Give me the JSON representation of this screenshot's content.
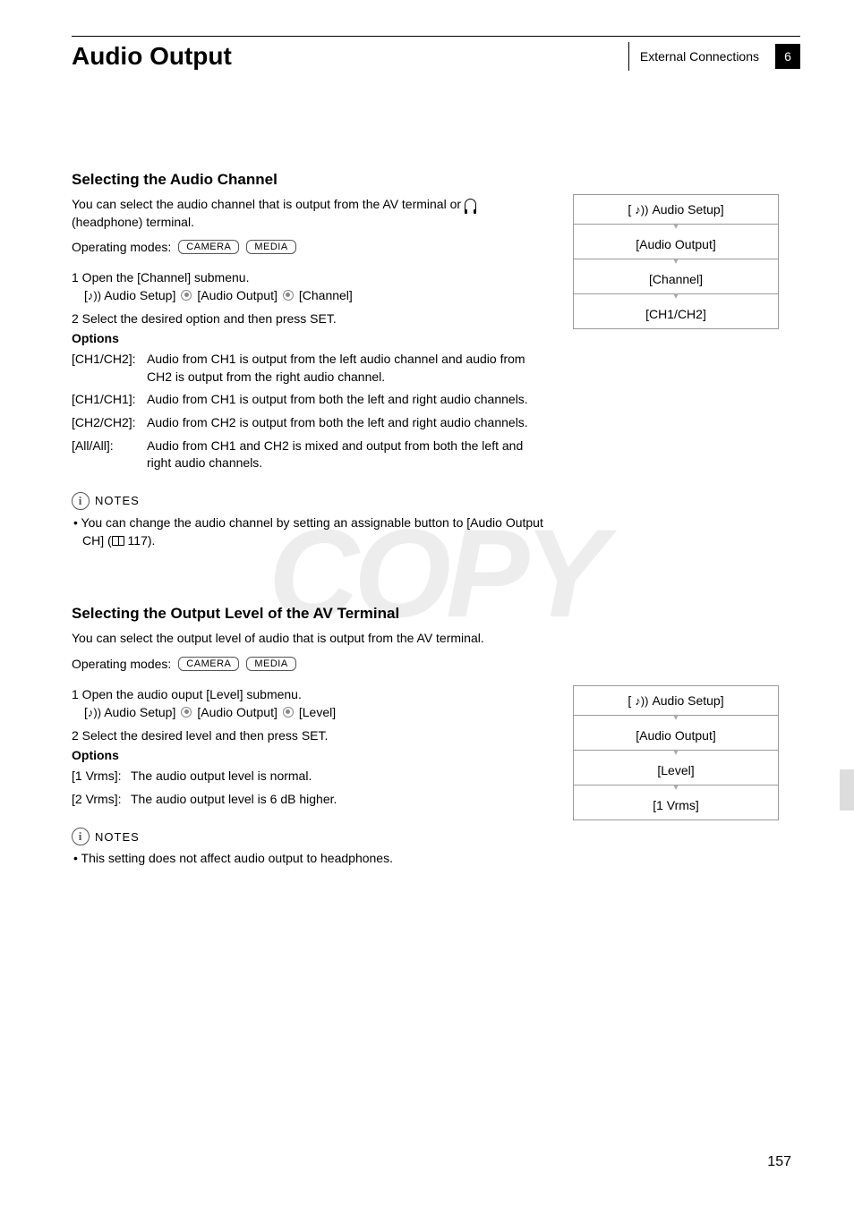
{
  "header": {
    "title": "Audio Output",
    "category": "External Connections",
    "chapter": "6"
  },
  "section1": {
    "title": "Selecting the Audio Channel",
    "intro_part1": "You can select the audio channel that is output from the AV terminal or ",
    "intro_part2": " (headphone) terminal.",
    "op_modes_label": "Operating modes:",
    "mode_camera": "CAMERA",
    "mode_media": "MEDIA",
    "step1": "1 Open the [Channel] submenu.",
    "path_audio_setup": "Audio Setup]",
    "path_audio_output": "[Audio Output]",
    "path_channel": "[Channel]",
    "step2": "2 Select the desired option and then press SET.",
    "options_label": "Options",
    "options": [
      {
        "key": "[CH1/CH2]:",
        "desc": "Audio from CH1 is output from the left audio channel and audio from CH2 is output from the right audio channel."
      },
      {
        "key": "[CH1/CH1]:",
        "desc": "Audio from CH1 is output from both the left and right audio channels."
      },
      {
        "key": "[CH2/CH2]:",
        "desc": "Audio from CH2 is output from both the left and right audio channels."
      },
      {
        "key": "[All/All]:",
        "desc": "Audio from CH1 and CH2 is mixed and output from both the left and right audio channels."
      }
    ],
    "notes_label": "NOTES",
    "note1_pre": "• You can change the audio channel by setting an assignable button to [Audio Output CH] (",
    "note1_page": " 117)."
  },
  "menu1": {
    "item1": "Audio Setup]",
    "item2": "[Audio Output]",
    "item3": "[Channel]",
    "item4": "[CH1/CH2]"
  },
  "section2": {
    "title": "Selecting the Output Level of the AV Terminal",
    "intro": "You can select the output level of audio that is output from the AV terminal.",
    "op_modes_label": "Operating modes:",
    "mode_camera": "CAMERA",
    "mode_media": "MEDIA",
    "step1": "1 Open the audio ouput [Level] submenu.",
    "path_audio_setup": "Audio Setup]",
    "path_audio_output": "[Audio Output]",
    "path_level": "[Level]",
    "step2": "2 Select the desired level and then press SET.",
    "options_label": "Options",
    "options": [
      {
        "key": "[1 Vrms]:",
        "desc": "The audio output level is normal."
      },
      {
        "key": "[2 Vrms]:",
        "desc": "The audio output level is 6 dB higher."
      }
    ],
    "notes_label": "NOTES",
    "note1": "• This setting does not affect audio output to headphones."
  },
  "menu2": {
    "item1": "Audio Setup]",
    "item2": "[Audio Output]",
    "item3": "[Level]",
    "item4": "[1 Vrms]"
  },
  "page_number": "157",
  "watermark": "COPY"
}
